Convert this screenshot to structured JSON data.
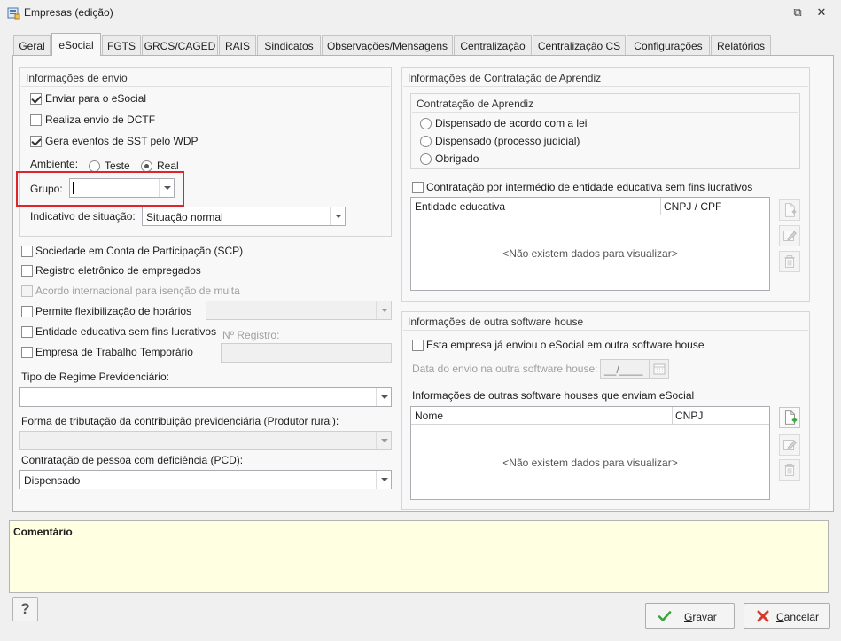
{
  "window": {
    "title": "Empresas (edição)",
    "restore_glyph": "⧉",
    "close_glyph": "✕"
  },
  "tabs": [
    {
      "label": "Geral"
    },
    {
      "label": "eSocial",
      "active": true
    },
    {
      "label": "FGTS"
    },
    {
      "label": "GRCS/CAGED"
    },
    {
      "label": "RAIS"
    },
    {
      "label": "Sindicatos"
    },
    {
      "label": "Observações/Mensagens"
    },
    {
      "label": "Centralização"
    },
    {
      "label": "Centralização CS"
    },
    {
      "label": "Configurações"
    },
    {
      "label": "Relatórios"
    }
  ],
  "envio": {
    "title": "Informações de envio",
    "enviar_esocial": {
      "label": "Enviar para o eSocial",
      "checked": true
    },
    "realiza_dctf": {
      "label": "Realiza envio de DCTF",
      "checked": false
    },
    "gera_sst": {
      "label": "Gera eventos de SST pelo WDP",
      "checked": true
    },
    "ambiente_label": "Ambiente:",
    "ambiente_teste": "Teste",
    "ambiente_real": "Real",
    "grupo_label": "Grupo:",
    "grupo_value": "",
    "indicativo_label": "Indicativo de situação:",
    "indicativo_value": "Situação normal"
  },
  "options": {
    "scp": "Sociedade em Conta de Participação (SCP)",
    "registro_eletronico": "Registro eletrônico de empregados",
    "acordo_internacional": "Acordo internacional para isenção de multa",
    "flexibilizacao": "Permite flexibilização de horários",
    "entidade_educativa": "Entidade educativa sem fins lucrativos",
    "trabalho_temporario": "Empresa de Trabalho Temporário",
    "registro_label": "Nº Registro:"
  },
  "regime": {
    "label": "Tipo de Regime Previdenciário:",
    "value": ""
  },
  "tributacao": {
    "label": "Forma de tributação da contribuição previdenciária (Produtor rural):",
    "value": ""
  },
  "pcd": {
    "label": "Contratação de pessoa com deficiência (PCD):",
    "value": "Dispensado"
  },
  "aprendiz": {
    "title": "Informações de Contratação de Aprendiz",
    "sub_title": "Contratação de Aprendiz",
    "radios": [
      "Dispensado de acordo com a lei",
      "Dispensado (processo judicial)",
      "Obrigado"
    ],
    "intermedio_label": "Contratação por intermédio de entidade educativa sem fins lucrativos",
    "grid_cols": [
      "Entidade educativa",
      "CNPJ / CPF"
    ],
    "empty": "<Não existem dados para visualizar>"
  },
  "software_house": {
    "title": "Informações de outra software house",
    "ja_enviou_label": "Esta empresa já enviou o eSocial em outra software house",
    "data_label": "Data do envio na outra software house:",
    "data_value": "__/____",
    "outras_label": "Informações de outras software houses que enviam eSocial",
    "grid_cols": [
      "Nome",
      "CNPJ"
    ],
    "empty": "<Não existem dados para visualizar>"
  },
  "comentario": {
    "title": "Comentário"
  },
  "footer": {
    "help": "?",
    "gravar_mnemonic": "G",
    "gravar_rest": "ravar",
    "cancelar_mnemonic": "C",
    "cancelar_rest": "ancelar"
  },
  "colors": {
    "highlight": "#e0242c",
    "comment_bg": "#ffffe1",
    "add_green": "#3aa53a",
    "cancel_red": "#d33a2c"
  }
}
